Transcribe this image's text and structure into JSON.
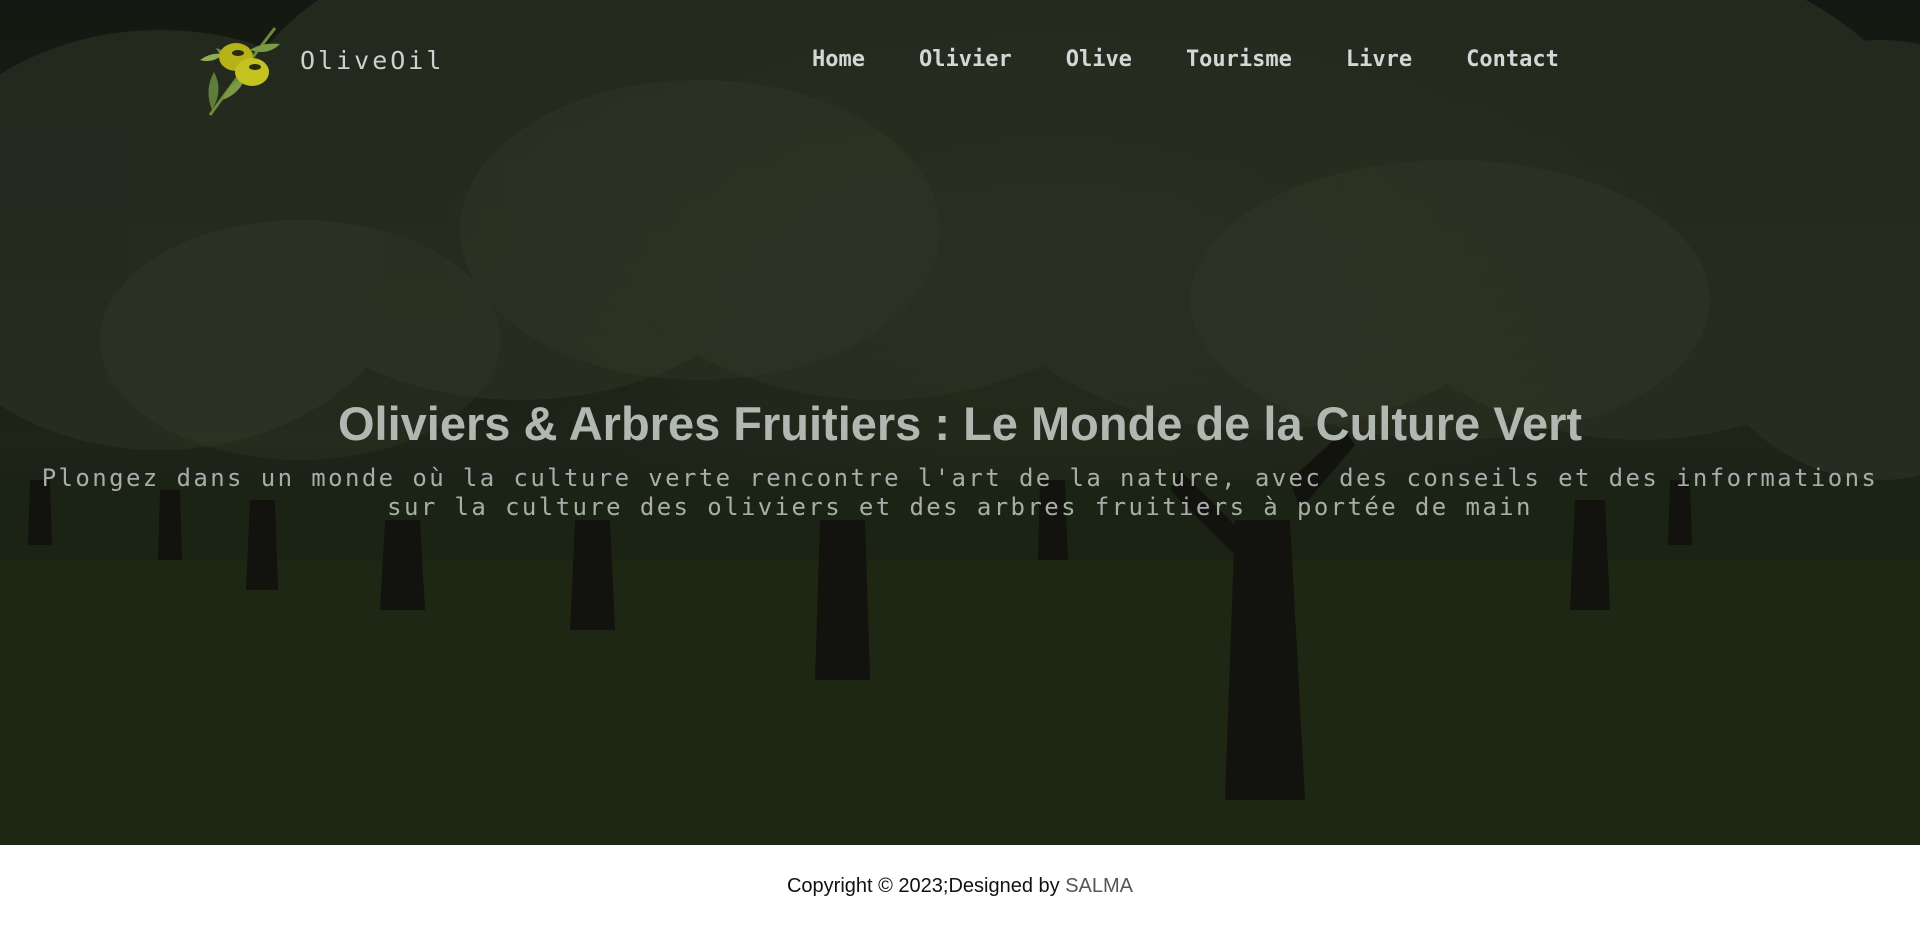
{
  "header": {
    "brand": "OliveOil",
    "logo_icon": "olive-branch-icon",
    "nav": [
      {
        "label": "Home"
      },
      {
        "label": "Olivier"
      },
      {
        "label": "Olive"
      },
      {
        "label": "Tourisme"
      },
      {
        "label": "Livre"
      },
      {
        "label": "Contact"
      }
    ]
  },
  "hero": {
    "title": "Oliviers & Arbres Fruitiers : Le Monde de la Culture Vert",
    "subtitle_line1": "Plongez dans un monde où la culture verte rencontre l'art de la nature, avec des conseils et des informations",
    "subtitle_line2": "sur la culture des oliviers et des arbres fruitiers à portée de main",
    "background": "olive-orchard-photo"
  },
  "footer": {
    "copyright": "Copyright © 2023;Designed by ",
    "author": "SALMA"
  },
  "colors": {
    "hero_title": "#b1b8b1",
    "nav_text": "#d6d6d6",
    "footer_bg": "#ffffff"
  }
}
